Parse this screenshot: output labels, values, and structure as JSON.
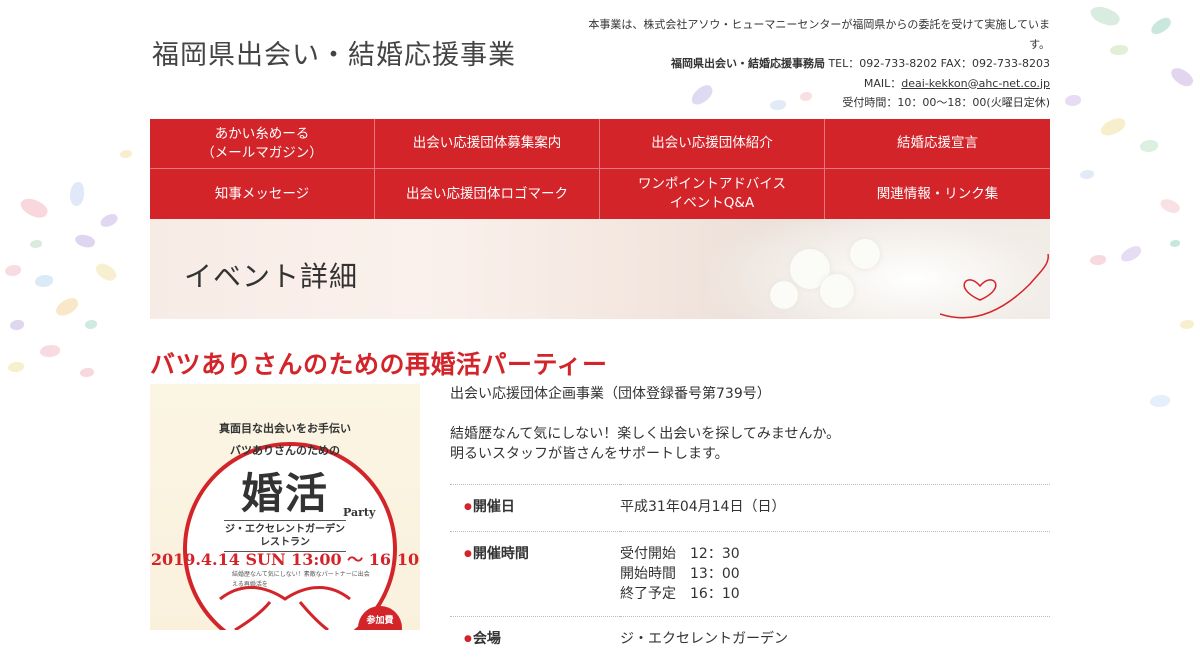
{
  "header": {
    "site_title": "福岡県出会い・結婚応援事業",
    "notice": "本事業は、株式会社アソウ・ヒューマニーセンターが福岡県からの委託を受けて実施しています。",
    "office_name": "福岡県出会い・結婚応援事務局",
    "contact": " TEL：092-733-8202 FAX：092-733-8203",
    "mail_label": "MAIL：",
    "mail": "deai-kekkon@ahc-net.co.jp",
    "hours": "受付時間：10：00～18：00(火曜日定休)"
  },
  "nav": {
    "items": [
      {
        "label": "あかい糸めーる\n（メールマガジン）"
      },
      {
        "label": "出会い応援団体募集案内"
      },
      {
        "label": "出会い応援団体紹介"
      },
      {
        "label": "結婚応援宣言"
      },
      {
        "label": "知事メッセージ"
      },
      {
        "label": "出会い応援団体ロゴマーク"
      },
      {
        "label": "ワンポイントアドバイス\nイベントQ&A"
      },
      {
        "label": "関連情報・リンク集"
      }
    ]
  },
  "banner": {
    "title": "イベント詳細"
  },
  "event": {
    "title": "バツありさんのための再婚活パーティー",
    "organizer": "出会い応援団体企画事業（団体登録番号第739号）",
    "description_1": "結婚歴なんて気にしない！楽しく出会いを探してみませんか。",
    "description_2": "明るいスタッフが皆さんをサポートします。",
    "rows": [
      {
        "label": "開催日",
        "value": "平成31年04月14日（日）"
      },
      {
        "label": "開催時間",
        "value": "受付開始　12：30\n開始時間　13：00\n終了予定　16：10"
      },
      {
        "label": "会場",
        "value": "ジ・エクセレントガーデン"
      }
    ]
  },
  "poster": {
    "top_line": "真面目な出会いをお手伝い",
    "sub_line": "バツありさんのための",
    "main": "婚活",
    "party": "Party",
    "venue": "ジ・エクセレントガーデン\nレストラン",
    "date": "2019.4.14 SUN 13:00 〜 16:10",
    "small": "結婚歴なんて気にしない！素敵なパートナーに出会える再婚活を",
    "badge": "参加費"
  },
  "colors": {
    "accent": "#d3242a"
  }
}
